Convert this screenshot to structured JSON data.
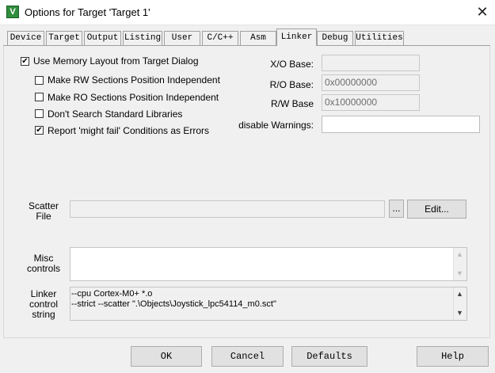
{
  "window": {
    "title": "Options for Target 'Target 1'",
    "icon": "uvision-icon",
    "close_glyph": "✕"
  },
  "tabs": [
    "Device",
    "Target",
    "Output",
    "Listing",
    "User",
    "C/C++",
    "Asm",
    "Linker",
    "Debug",
    "Utilities"
  ],
  "active_tab": "Linker",
  "options": [
    {
      "label": "Use Memory Layout from Target Dialog",
      "checked": true
    },
    {
      "label": "Make RW Sections Position Independent",
      "checked": false
    },
    {
      "label": "Make RO Sections Position Independent",
      "checked": false
    },
    {
      "label": "Don't Search Standard Libraries",
      "checked": false
    },
    {
      "label": "Report 'might fail' Conditions as Errors",
      "checked": true
    }
  ],
  "bases": {
    "xo_label": "X/O Base:",
    "xo_value": "",
    "ro_label": "R/O Base:",
    "ro_value": "0x00000000",
    "rw_label": "R/W Base",
    "rw_value": "0x10000000",
    "warn_label": "disable Warnings:",
    "warn_value": ""
  },
  "scatter": {
    "label_line1": "Scatter",
    "label_line2": "File",
    "value": "",
    "browse_label": "...",
    "edit_label": "Edit..."
  },
  "misc": {
    "label_line1": "Misc",
    "label_line2": "controls",
    "value": ""
  },
  "linker_control": {
    "label_line1": "Linker",
    "label_line2": "control",
    "label_line3": "string",
    "line1": "--cpu Cortex-M0+ *.o",
    "line2": "--strict --scatter \".\\Objects\\Joystick_lpc54114_m0.sct\""
  },
  "buttons": {
    "ok": "OK",
    "cancel": "Cancel",
    "defaults": "Defaults",
    "help": "Help"
  },
  "check_glyph": "✔",
  "scroll": {
    "up": "▲",
    "down": "▼"
  }
}
